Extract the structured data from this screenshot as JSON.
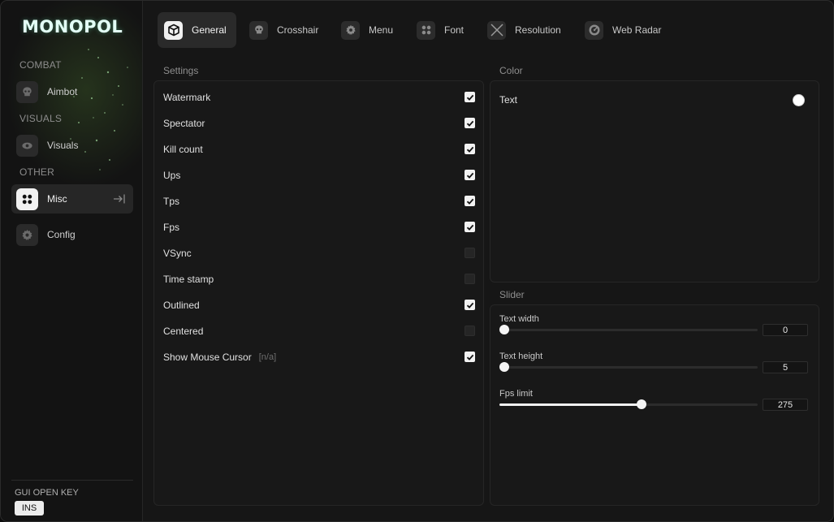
{
  "app": {
    "logo": "MONOPOL"
  },
  "sidebar": {
    "sections": [
      {
        "label": "COMBAT",
        "items": [
          {
            "label": "Aimbot",
            "icon": "skull-icon",
            "active": false
          }
        ]
      },
      {
        "label": "VISUALS",
        "items": [
          {
            "label": "Visuals",
            "icon": "eye-icon",
            "active": false
          }
        ]
      },
      {
        "label": "OTHER",
        "items": [
          {
            "label": "Misc",
            "icon": "four-dots-icon",
            "active": true
          },
          {
            "label": "Config",
            "icon": "gear-icon",
            "active": false
          }
        ]
      }
    ],
    "gui_key": {
      "label": "GUI OPEN KEY",
      "value": "INS"
    }
  },
  "tabs": [
    {
      "label": "General",
      "icon": "cube-icon",
      "active": true
    },
    {
      "label": "Crosshair",
      "icon": "skull-icon",
      "active": false
    },
    {
      "label": "Menu",
      "icon": "gear-icon",
      "active": false
    },
    {
      "label": "Font",
      "icon": "four-dots-icon",
      "active": false
    },
    {
      "label": "Resolution",
      "icon": "cross-icon",
      "active": false
    },
    {
      "label": "Web Radar",
      "icon": "radar-icon",
      "active": false
    }
  ],
  "settings": {
    "title": "Settings",
    "items": [
      {
        "label": "Watermark",
        "checked": true
      },
      {
        "label": "Spectator",
        "checked": true
      },
      {
        "label": "Kill count",
        "checked": true
      },
      {
        "label": "Ups",
        "checked": true
      },
      {
        "label": "Tps",
        "checked": true
      },
      {
        "label": "Fps",
        "checked": true
      },
      {
        "label": "VSync",
        "checked": false
      },
      {
        "label": "Time stamp",
        "checked": false
      },
      {
        "label": "Outlined",
        "checked": true
      },
      {
        "label": "Centered",
        "checked": false
      },
      {
        "label": "Show Mouse Cursor",
        "note": "[n/a]",
        "checked": true
      }
    ]
  },
  "color": {
    "title": "Color",
    "items": [
      {
        "label": "Text",
        "value": "#ffffff"
      }
    ]
  },
  "slider": {
    "title": "Slider",
    "items": [
      {
        "label": "Text width",
        "value": "0",
        "fraction": 0.0
      },
      {
        "label": "Text height",
        "value": "5",
        "fraction": 0.0
      },
      {
        "label": "Fps limit",
        "value": "275",
        "fraction": 0.55
      }
    ]
  }
}
